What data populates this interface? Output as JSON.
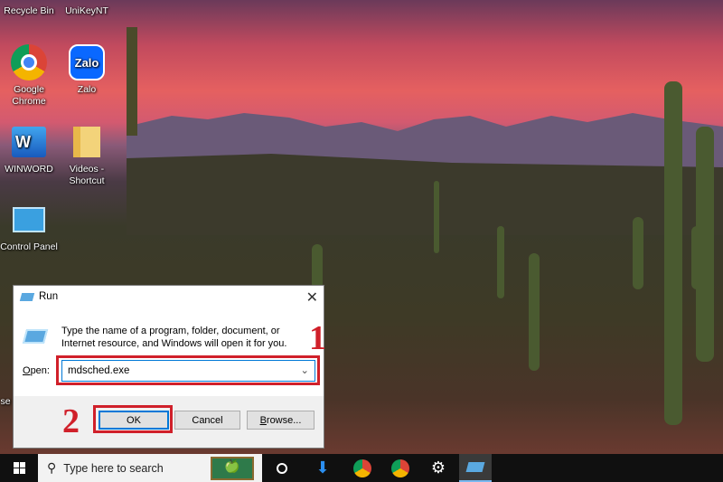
{
  "desktop": {
    "icons": [
      {
        "label": "Recycle Bin"
      },
      {
        "label": "UniKeyNT"
      },
      {
        "label": "Google Chrome"
      },
      {
        "label": "Zalo"
      },
      {
        "label": "WINWORD"
      },
      {
        "label": "Videos - Shortcut"
      },
      {
        "label": "Control Panel"
      }
    ],
    "zalo_logo": "Zalo",
    "word_logo": "W",
    "partial_label": "se"
  },
  "run_dialog": {
    "title": "Run",
    "description": "Type the name of a program, folder, document, or Internet resource, and Windows will open it for you.",
    "open_label": "Open:",
    "open_value": "mdsched.exe",
    "ok": "OK",
    "cancel": "Cancel",
    "browse": "Browse..."
  },
  "annotations": {
    "step1": "1",
    "step2": "2",
    "color": "#d0202a"
  },
  "taskbar": {
    "search_placeholder": "Type here to search"
  }
}
